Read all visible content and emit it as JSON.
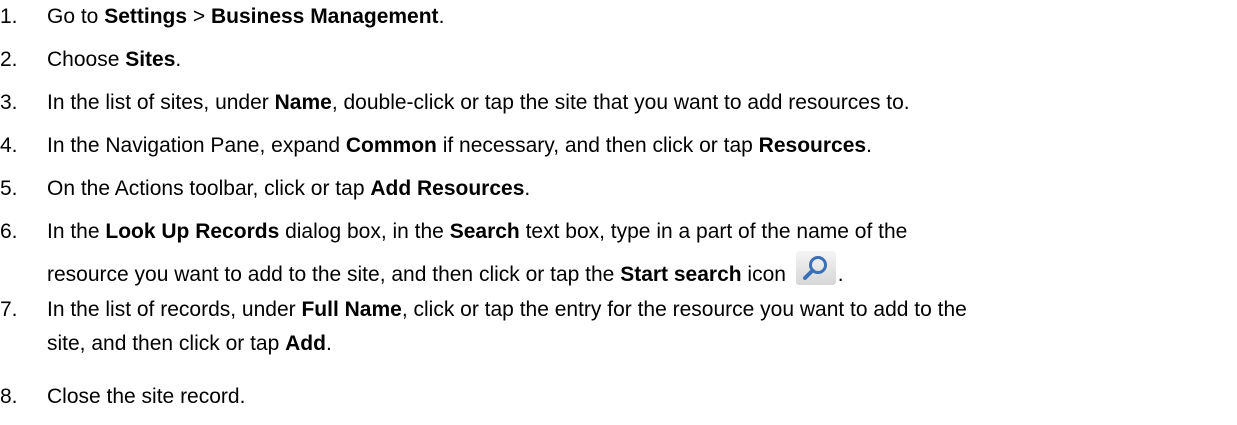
{
  "steps": [
    {
      "num": "1.",
      "parts": [
        "Go to ",
        "Settings",
        " > ",
        "Business Management",
        "."
      ]
    },
    {
      "num": "2.",
      "parts": [
        "Choose ",
        "Sites",
        "."
      ]
    },
    {
      "num": "3.",
      "parts": [
        "In the list of sites, under ",
        "Name",
        ", double-click or tap the site that you want to add resources to."
      ]
    },
    {
      "num": "4.",
      "parts": [
        "In the Navigation Pane, expand ",
        "Common",
        " if necessary, and then click or tap ",
        "Resources",
        "."
      ]
    },
    {
      "num": "5.",
      "parts": [
        "On the Actions toolbar, click or tap ",
        "Add Resources",
        "."
      ]
    },
    {
      "num": "6.",
      "line1": [
        "In the ",
        "Look Up Records",
        " dialog box, in the ",
        "Search",
        " text box, type in a part of the name of the"
      ],
      "line2": [
        "resource you want to add to the site, and then click or tap the ",
        "Start search",
        " icon ",
        "."
      ]
    },
    {
      "num": "7.",
      "line1": [
        "In the list of records, under ",
        "Full Name",
        ", click or tap the entry for the resource you want to add to the"
      ],
      "line2": [
        "site, and then click or tap ",
        "Add",
        "."
      ]
    },
    {
      "num": "8.",
      "parts": [
        "Close the site record."
      ]
    }
  ],
  "icons": {
    "start_search": "magnifier-icon"
  }
}
